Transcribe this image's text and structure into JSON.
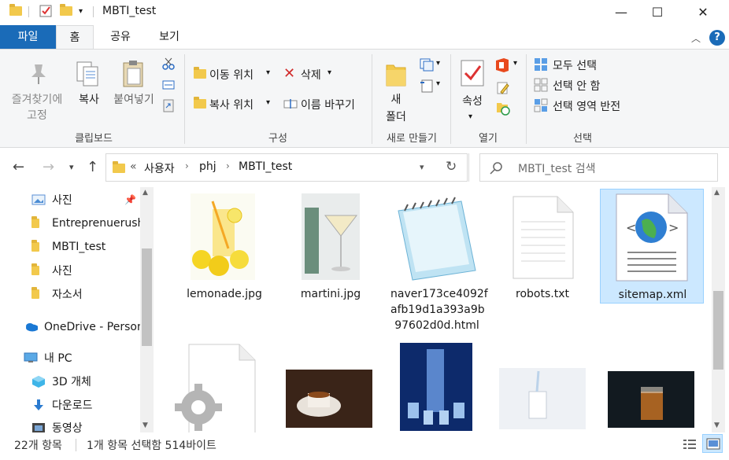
{
  "window": {
    "title": "MBTI_test",
    "minimize": "—",
    "maximize": "☐",
    "close": "✕"
  },
  "tabs": {
    "file": "파일",
    "home": "홈",
    "share": "공유",
    "view": "보기"
  },
  "ribbon": {
    "clipboard": {
      "pin_label_1": "즐겨찾기에",
      "pin_label_2": "고정",
      "copy": "복사",
      "paste": "붙여넣기",
      "group": "클립보드"
    },
    "organize": {
      "move_to": "이동 위치",
      "copy_to": "복사 위치",
      "delete": "삭제",
      "rename": "이름 바꾸기",
      "group": "구성"
    },
    "new": {
      "new_folder_1": "새",
      "new_folder_2": "폴더",
      "group": "새로 만들기"
    },
    "open": {
      "properties": "속성",
      "group": "열기"
    },
    "select": {
      "select_all": "모두 선택",
      "select_none": "선택 안 함",
      "invert": "선택 영역 반전",
      "group": "선택"
    }
  },
  "address": {
    "chevron": "«",
    "crumbs": [
      "사용자",
      "phj",
      "MBTI_test"
    ],
    "search_placeholder": "MBTI_test 검색"
  },
  "nav": {
    "items": [
      {
        "label": "사진",
        "icon": "pictures-icon"
      },
      {
        "label": "Entreprenuerush",
        "icon": "folder-icon"
      },
      {
        "label": "MBTI_test",
        "icon": "folder-icon"
      },
      {
        "label": "사진",
        "icon": "folder-icon"
      },
      {
        "label": "자소서",
        "icon": "folder-icon"
      },
      {
        "label": "OneDrive - Person",
        "icon": "onedrive-icon"
      },
      {
        "label": "내 PC",
        "icon": "pc-icon"
      },
      {
        "label": "3D 개체",
        "icon": "3d-objects-icon"
      },
      {
        "label": "다운로드",
        "icon": "download-icon"
      },
      {
        "label": "동영상",
        "icon": "video-icon"
      }
    ]
  },
  "files": [
    {
      "name": "lemonade.jpg"
    },
    {
      "name": "martini.jpg"
    },
    {
      "name": "naver173ce4092f\nafb19d1a393a9b\n97602d0d.html"
    },
    {
      "name": "robots.txt"
    },
    {
      "name": "sitemap.xml"
    }
  ],
  "status": {
    "count": "22개 항목",
    "selection": "1개 항목 선택함 514바이트"
  },
  "colors": {
    "accent": "#1a6bb8",
    "selection_bg": "#cce8ff",
    "folder": "#f2c94c"
  }
}
